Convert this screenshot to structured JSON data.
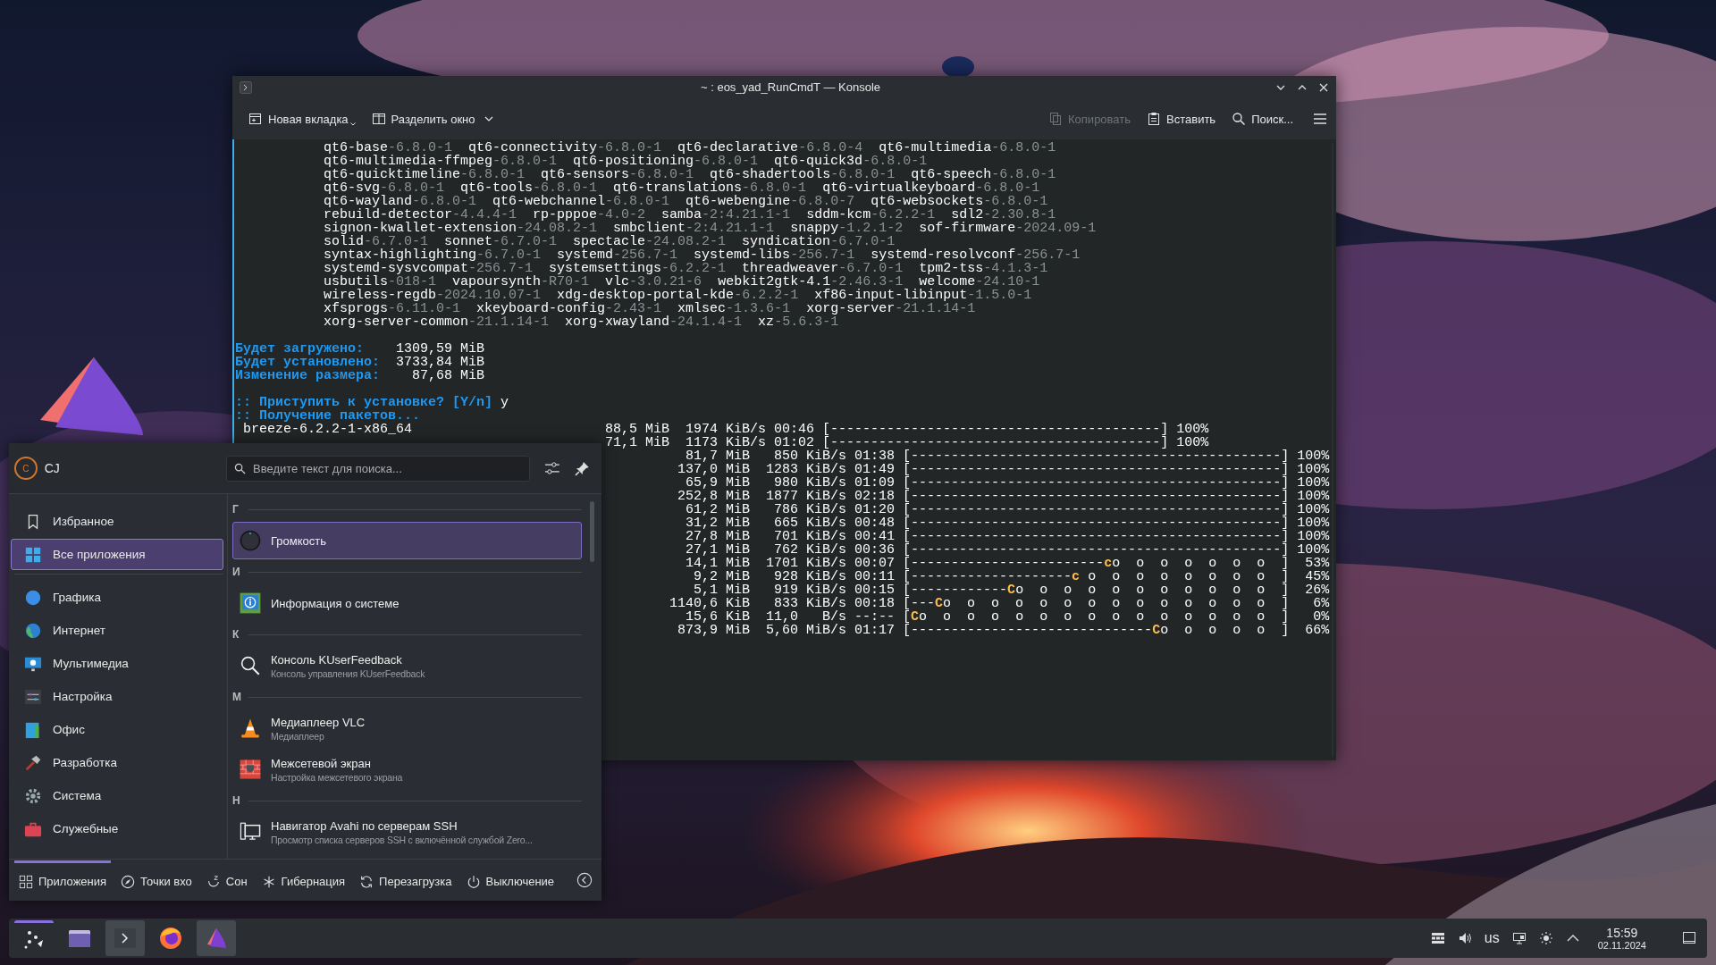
{
  "konsole": {
    "title": "~ : eos_yad_RunCmdT — Konsole",
    "toolbar": [
      {
        "label": "Новая вкладка",
        "kind": "new-tab",
        "disabled": false
      },
      {
        "label": "Разделить окно",
        "kind": "split",
        "disabled": false
      },
      {
        "label": "Копировать",
        "kind": "copy",
        "disabled": true
      },
      {
        "label": "Вставить",
        "kind": "paste",
        "disabled": false
      },
      {
        "label": "Поиск...",
        "kind": "search",
        "disabled": false
      }
    ],
    "terminal": {
      "packages": [
        [
          {
            "name": "qt6-base",
            "version": "-6.8.0-1"
          },
          {
            "name": "qt6-connectivity",
            "version": "-6.8.0-1"
          },
          {
            "name": "qt6-declarative",
            "version": "-6.8.0-4"
          },
          {
            "name": "qt6-multimedia",
            "version": "-6.8.0-1"
          }
        ],
        [
          {
            "name": "qt6-multimedia-ffmpeg",
            "version": "-6.8.0-1"
          },
          {
            "name": "qt6-positioning",
            "version": "-6.8.0-1"
          },
          {
            "name": "qt6-quick3d",
            "version": "-6.8.0-1"
          }
        ],
        [
          {
            "name": "qt6-quicktimeline",
            "version": "-6.8.0-1"
          },
          {
            "name": "qt6-sensors",
            "version": "-6.8.0-1"
          },
          {
            "name": "qt6-shadertools",
            "version": "-6.8.0-1"
          },
          {
            "name": "qt6-speech",
            "version": "-6.8.0-1"
          }
        ],
        [
          {
            "name": "qt6-svg",
            "version": "-6.8.0-1"
          },
          {
            "name": "qt6-tools",
            "version": "-6.8.0-1"
          },
          {
            "name": "qt6-translations",
            "version": "-6.8.0-1"
          },
          {
            "name": "qt6-virtualkeyboard",
            "version": "-6.8.0-1"
          }
        ],
        [
          {
            "name": "qt6-wayland",
            "version": "-6.8.0-1"
          },
          {
            "name": "qt6-webchannel",
            "version": "-6.8.0-1"
          },
          {
            "name": "qt6-webengine",
            "version": "-6.8.0-7"
          },
          {
            "name": "qt6-websockets",
            "version": "-6.8.0-1"
          }
        ],
        [
          {
            "name": "rebuild-detector",
            "version": "-4.4.4-1"
          },
          {
            "name": "rp-pppoe",
            "version": "-4.0-2"
          },
          {
            "name": "samba",
            "version": "-2:4.21.1-1"
          },
          {
            "name": "sddm-kcm",
            "version": "-6.2.2-1"
          },
          {
            "name": "sdl2",
            "version": "-2.30.8-1"
          }
        ],
        [
          {
            "name": "signon-kwallet-extension",
            "version": "-24.08.2-1"
          },
          {
            "name": "smbclient",
            "version": "-2:4.21.1-1"
          },
          {
            "name": "snappy",
            "version": "-1.2.1-2"
          },
          {
            "name": "sof-firmware",
            "version": "-2024.09-1"
          }
        ],
        [
          {
            "name": "solid",
            "version": "-6.7.0-1"
          },
          {
            "name": "sonnet",
            "version": "-6.7.0-1"
          },
          {
            "name": "spectacle",
            "version": "-24.08.2-1"
          },
          {
            "name": "syndication",
            "version": "-6.7.0-1"
          }
        ],
        [
          {
            "name": "syntax-highlighting",
            "version": "-6.7.0-1"
          },
          {
            "name": "systemd",
            "version": "-256.7-1"
          },
          {
            "name": "systemd-libs",
            "version": "-256.7-1"
          },
          {
            "name": "systemd-resolvconf",
            "version": "-256.7-1"
          }
        ],
        [
          {
            "name": "systemd-sysvcompat",
            "version": "-256.7-1"
          },
          {
            "name": "systemsettings",
            "version": "-6.2.2-1"
          },
          {
            "name": "threadweaver",
            "version": "-6.7.0-1"
          },
          {
            "name": "tpm2-tss",
            "version": "-4.1.3-1"
          }
        ],
        [
          {
            "name": "usbutils",
            "version": "-018-1"
          },
          {
            "name": "vapoursynth",
            "version": "-R70-1"
          },
          {
            "name": "vlc",
            "version": "-3.0.21-6"
          },
          {
            "name": "webkit2gtk-4.1",
            "version": "-2.46.3-1"
          },
          {
            "name": "welcome",
            "version": "-24.10-1"
          }
        ],
        [
          {
            "name": "wireless-regdb",
            "version": "-2024.10.07-1"
          },
          {
            "name": "xdg-desktop-portal-kde",
            "version": "-6.2.2-1"
          },
          {
            "name": "xf86-input-libinput",
            "version": "-1.5.0-1"
          }
        ],
        [
          {
            "name": "xfsprogs",
            "version": "-6.11.0-1"
          },
          {
            "name": "xkeyboard-config",
            "version": "-2.43-1"
          },
          {
            "name": "xmlsec",
            "version": "-1.3.6-1"
          },
          {
            "name": "xorg-server",
            "version": "-21.1.14-1"
          }
        ],
        [
          {
            "name": "xorg-server-common",
            "version": "-21.1.14-1"
          },
          {
            "name": "xorg-xwayland",
            "version": "-24.1.4-1"
          },
          {
            "name": "xz",
            "version": "-5.6.3-1"
          }
        ]
      ],
      "summary": [
        {
          "label": "Будет загружено:",
          "value": "1309,59 MiB"
        },
        {
          "label": "Будет установлено:",
          "value": "3733,84 MiB"
        },
        {
          "label": "Изменение размера:",
          "value": "87,68 MiB"
        }
      ],
      "prompt": {
        "question": ":: Приступить к установке? [Y/n]",
        "answer": "y"
      },
      "status": ":: Получение пакетов...",
      "downloads": [
        {
          "kind": "narrow",
          "name": "breeze-6.2.2-1-x86_64",
          "size": "88,5 MiB",
          "speed": "1974 KiB/s",
          "time": "00:46",
          "bar": "[-----------------------------------------]",
          "percent": "100%"
        },
        {
          "kind": "narrow",
          "size": "71,1 MiB",
          "speed": "1173 KiB/s",
          "time": "01:02",
          "bar": "[-----------------------------------------]",
          "percent": "100%"
        },
        {
          "kind": "wide",
          "size": "81,7 MiB",
          "speed": "850 KiB/s",
          "time": "01:38",
          "bar": "[----------------------------------------------]",
          "percent": "100%"
        },
        {
          "kind": "wide",
          "size": "137,0 MiB",
          "speed": "1283 KiB/s",
          "time": "01:49",
          "bar": "[----------------------------------------------]",
          "percent": "100%"
        },
        {
          "kind": "wide",
          "size": "65,9 MiB",
          "speed": "980 KiB/s",
          "time": "01:09",
          "bar": "[----------------------------------------------]",
          "percent": "100%"
        },
        {
          "kind": "wide",
          "size": "252,8 MiB",
          "speed": "1877 KiB/s",
          "time": "02:18",
          "bar": "[----------------------------------------------]",
          "percent": "100%"
        },
        {
          "kind": "wide",
          "size": "61,2 MiB",
          "speed": "786 KiB/s",
          "time": "01:20",
          "bar": "[----------------------------------------------]",
          "percent": "100%"
        },
        {
          "kind": "wide",
          "size": "31,2 MiB",
          "speed": "665 KiB/s",
          "time": "00:48",
          "bar": "[----------------------------------------------]",
          "percent": "100%"
        },
        {
          "kind": "wide",
          "size": "27,8 MiB",
          "speed": "701 KiB/s",
          "time": "00:41",
          "bar": "[----------------------------------------------]",
          "percent": "100%"
        },
        {
          "kind": "wide",
          "size": "27,1 MiB",
          "speed": "762 KiB/s",
          "time": "00:36",
          "bar": "[----------------------------------------------]",
          "percent": "100%"
        },
        {
          "kind": "wide",
          "size": "14,1 MiB",
          "speed": "1701 KiB/s",
          "time": "00:07",
          "bar": "[------------------------",
          "pac": "c",
          "bar_tail": "o  o  o  o  o  o  o  ]",
          "percent": "53%"
        },
        {
          "kind": "wide",
          "size": "9,2 MiB",
          "speed": "928 KiB/s",
          "time": "00:11",
          "bar": "[--------------------",
          "pac": "c",
          "bar_tail": " o  o  o  o  o  o  o  o  ]",
          "percent": "45%"
        },
        {
          "kind": "wide",
          "size": "5,1 MiB",
          "speed": "919 KiB/s",
          "time": "00:15",
          "bar": "[------------",
          "pac": "C",
          "bar_tail": "o  o  o  o  o  o  o  o  o  o  o  ]",
          "percent": "26%"
        },
        {
          "kind": "wide",
          "size": "1140,6 KiB",
          "speed": "833 KiB/s",
          "time": "00:18",
          "bar": "[---",
          "pac": "C",
          "bar_tail": "o  o  o  o  o  o  o  o  o  o  o  o  o  o  ]",
          "percent": "6%"
        },
        {
          "kind": "wide",
          "size": "15,6 KiB",
          "speed": "11,0   B/s",
          "time": "--:--",
          "bar": "[",
          "pac": "C",
          "bar_tail": "o  o  o  o  o  o  o  o  o  o  o  o  o  o  o  ]",
          "percent": "0%"
        },
        {
          "kind": "wide",
          "size": "873,9 MiB",
          "speed": "5,60 MiB/s",
          "time": "01:17",
          "bar": "[------------------------------",
          "pac": "C",
          "bar_tail": "o  o  o  o  o  ]",
          "percent": "66%"
        }
      ]
    }
  },
  "launcher": {
    "user": {
      "initial": "C",
      "name": "CJ"
    },
    "search": {
      "placeholder": "Введите текст для поиска..."
    },
    "categories": [
      {
        "label": "Избранное",
        "kind": "favorites",
        "selected": false
      },
      {
        "label": "Все приложения",
        "kind": "all",
        "selected": true
      },
      {
        "label": "Графика",
        "kind": "graphics",
        "selected": false
      },
      {
        "label": "Интернет",
        "kind": "internet",
        "selected": false
      },
      {
        "label": "Мультимедиа",
        "kind": "multimedia",
        "selected": false
      },
      {
        "label": "Настройка",
        "kind": "settings",
        "selected": false
      },
      {
        "label": "Офис",
        "kind": "office",
        "selected": false
      },
      {
        "label": "Разработка",
        "kind": "development",
        "selected": false
      },
      {
        "label": "Система",
        "kind": "system",
        "selected": false
      },
      {
        "label": "Служебные",
        "kind": "utilities",
        "selected": false
      }
    ],
    "sections": [
      {
        "letter": "Г",
        "apps": [
          {
            "name": "Громкость",
            "kind": "volume",
            "selected": true
          }
        ]
      },
      {
        "letter": "И",
        "apps": [
          {
            "name": "Информация о системе",
            "kind": "sysinfo",
            "selected": false
          }
        ]
      },
      {
        "letter": "К",
        "apps": [
          {
            "name": "Консоль KUserFeedback",
            "description": "Консоль управления KUserFeedback",
            "kind": "magnifier",
            "selected": false
          }
        ]
      },
      {
        "letter": "М",
        "apps": [
          {
            "name": "Медиаплеер VLC",
            "description": "Медиаплеер",
            "kind": "vlc",
            "selected": false
          },
          {
            "name": "Межсетевой экран",
            "description": "Настройка межсетевого экрана",
            "kind": "firewall",
            "selected": false
          }
        ]
      },
      {
        "letter": "Н",
        "apps": [
          {
            "name": "Навигатор Avahi по серверам SSH",
            "description": "Просмотр списка серверов SSH с включённой службой Zero...",
            "kind": "network",
            "selected": false
          }
        ]
      }
    ],
    "footer_tabs": [
      {
        "label": "Приложения",
        "kind": "apps",
        "selected": true
      },
      {
        "label": "Точки вхо",
        "kind": "places",
        "selected": false
      }
    ],
    "power_actions": [
      {
        "label": "Сон",
        "kind": "sleep"
      },
      {
        "label": "Гибернация",
        "kind": "hibernate"
      },
      {
        "label": "Перезагрузка",
        "kind": "restart"
      },
      {
        "label": "Выключение",
        "kind": "shutdown"
      }
    ]
  },
  "taskbar": {
    "apps": [
      {
        "kind": "launcher",
        "active": true
      },
      {
        "kind": "files",
        "active": false
      },
      {
        "kind": "terminal",
        "active": true
      },
      {
        "kind": "browser",
        "active": false
      },
      {
        "kind": "welcome",
        "active": true
      }
    ],
    "tray": {
      "layout": "us",
      "time": "15:59",
      "date": "02.11.2024"
    }
  }
}
